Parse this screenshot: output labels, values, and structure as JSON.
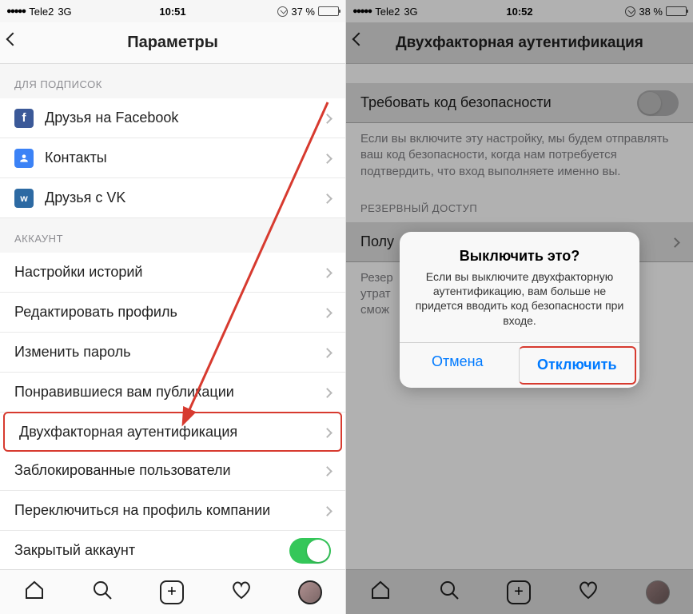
{
  "left": {
    "status": {
      "carrier": "Tele2",
      "network": "3G",
      "time": "10:51",
      "battery_pct": "37 %",
      "battery_fill": "37%"
    },
    "nav_title": "Параметры",
    "section_follow": "ДЛЯ ПОДПИСОК",
    "follow_fb": "Друзья на Facebook",
    "follow_contacts": "Контакты",
    "follow_vk": "Друзья с VK",
    "section_account": "АККАУНТ",
    "acc_items": {
      "stories": "Настройки историй",
      "edit": "Редактировать профиль",
      "password": "Изменить пароль",
      "liked": "Понравившиеся вам публикации",
      "twofa": "Двухфакторная аутентификация",
      "blocked": "Заблокированные пользователи",
      "switch_biz": "Переключиться на профиль компании",
      "private": "Закрытый аккаунт"
    }
  },
  "right": {
    "status": {
      "carrier": "Tele2",
      "network": "3G",
      "time": "10:52",
      "battery_pct": "38 %",
      "battery_fill": "38%"
    },
    "nav_title": "Двухфакторная аутентификация",
    "require_code": "Требовать код безопасности",
    "require_desc": "Если вы включите эту настройку, мы будем отправлять ваш код безопасности, когда нам потребуется подтвердить, что вход выполняете именно вы.",
    "section_backup": "РЕЗЕРВНЫЙ ДОСТУП",
    "get_codes": "Полу",
    "codes_desc": "Резер\nутрат\nсмож",
    "alert": {
      "title": "Выключить это?",
      "msg": "Если вы выключите двухфакторную аутентификацию, вам больше не придется вводить код безопасности при входе.",
      "cancel": "Отмена",
      "disable": "Отключить"
    }
  }
}
